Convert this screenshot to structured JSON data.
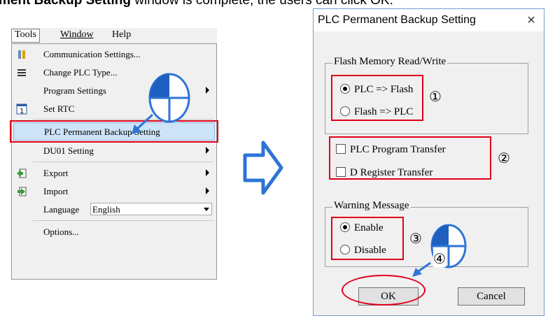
{
  "caption": {
    "bold": "ment Backup Setting",
    "rest": " window is complete, the users can click OK."
  },
  "menubar": {
    "tools": "Tools",
    "window": "Window",
    "help": "Help"
  },
  "tools_menu": {
    "items": [
      {
        "label": "Communication Settings...",
        "icon": "communication-icon"
      },
      {
        "label": "Change PLC Type...",
        "icon": "change-plc-icon"
      },
      {
        "label": "Program Settings",
        "icon": ""
      },
      {
        "label": "Set RTC",
        "icon": "rtc-icon"
      },
      {
        "label": "PLC Permanent Backup Setting",
        "icon": ""
      },
      {
        "label": "DU01 Setting",
        "icon": ""
      },
      {
        "label": "Export",
        "icon": "export-icon"
      },
      {
        "label": "Import",
        "icon": "import-icon"
      },
      {
        "label": "Language",
        "icon": ""
      },
      {
        "label": "Options...",
        "icon": ""
      }
    ],
    "language_value": "English"
  },
  "dialog": {
    "title": "PLC Permanent Backup Setting",
    "close": "×",
    "flash_group": "Flash Memory Read/Write",
    "flash_opt1": "PLC => Flash",
    "flash_opt2": "Flash => PLC",
    "transfer_opt1": "PLC Program Transfer",
    "transfer_opt2": "D Register Transfer",
    "warning_group": "Warning Message",
    "warning_opt1": "Enable",
    "warning_opt2": "Disable",
    "ok": "OK",
    "cancel": "Cancel"
  },
  "steps": {
    "s1": "①",
    "s2": "②",
    "s3": "③",
    "s4": "④"
  },
  "colors": {
    "highlight_red": "#e0001a",
    "arrow_blue": "#2e74d6",
    "menu_hover": "#cde3f7"
  }
}
